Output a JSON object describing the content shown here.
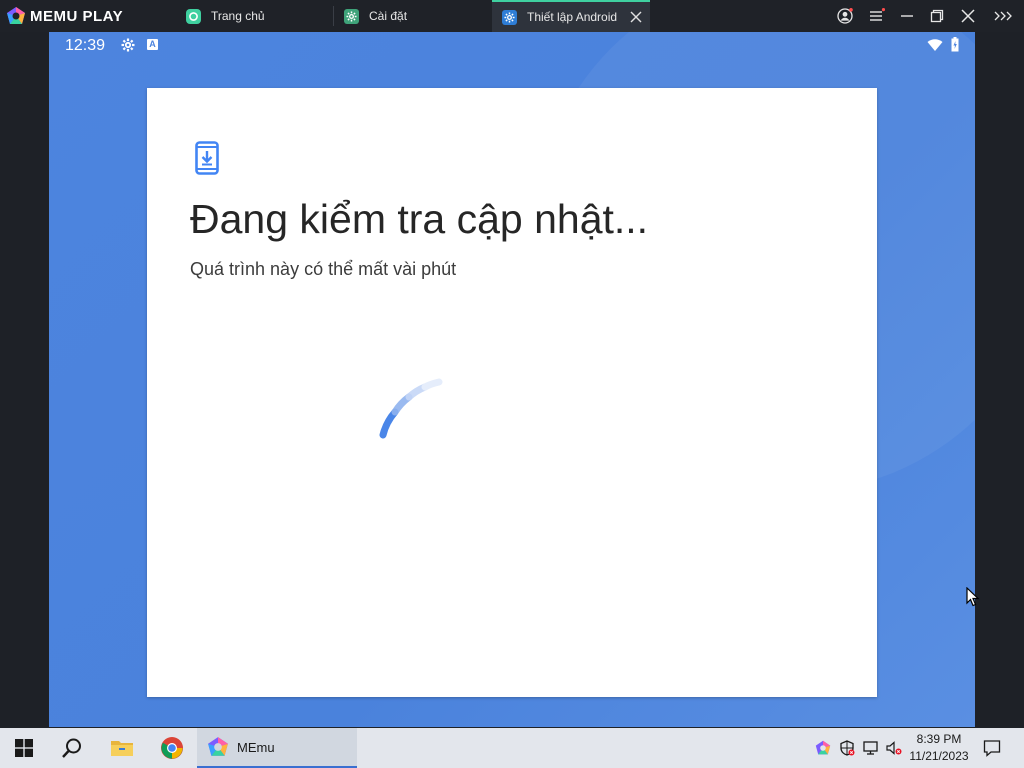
{
  "titlebar": {
    "brand": "MEMU PL",
    "brand_play": "AY",
    "tabs": [
      {
        "label": "Trang chủ",
        "icon": "android-home-icon"
      },
      {
        "label": "Cài đặt",
        "icon": "settings-gear-icon"
      },
      {
        "label": "Thiết lập Android",
        "icon": "settings-gear-icon",
        "active": true
      }
    ],
    "controls": [
      "account-icon",
      "menu-icon",
      "minimize-icon",
      "restore-icon",
      "close-icon",
      "expand-sidebar-icon"
    ]
  },
  "android": {
    "status_bar": {
      "time": "12:39",
      "icons": [
        "gear-icon",
        "a-notification-icon",
        "wifi-icon",
        "battery-icon"
      ]
    },
    "card": {
      "icon": "phone-download-icon",
      "title": "Đang kiểm tra cập nhật...",
      "subtitle": "Quá trình này có thể mất vài phút"
    }
  },
  "taskbar": {
    "items": [
      "windows-start-icon",
      "search-icon",
      "file-explorer-icon",
      "chrome-icon"
    ],
    "active_app": {
      "label": "MEmu",
      "icon": "memu-icon"
    },
    "tray_icons": [
      "memu-tray-icon",
      "security-icon",
      "network-icon",
      "volume-muted-icon"
    ],
    "time": "8:39 PM",
    "date": "11/21/2023",
    "notification_icon": "notification-icon"
  },
  "colors": {
    "android_bg": "#4d84de",
    "accent": "#3fd0a0",
    "spinner": "#4285f4"
  }
}
